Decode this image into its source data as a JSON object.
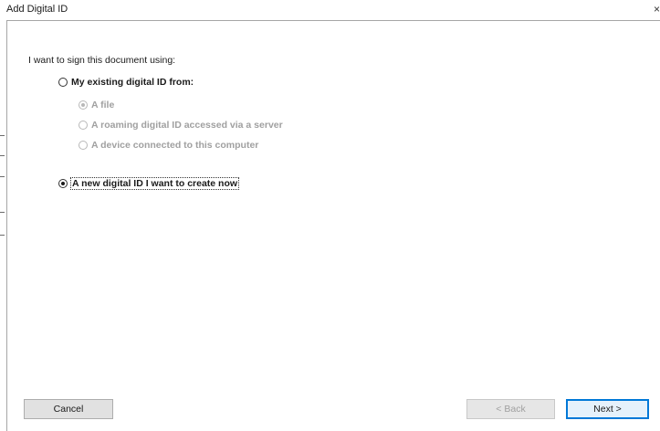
{
  "window": {
    "title": "Add Digital ID",
    "close_glyph": "×"
  },
  "form": {
    "intro": "I want to sign this document using:",
    "existing_option": {
      "label": "My existing digital ID from:",
      "selected": false
    },
    "sub_options": [
      {
        "label": "A file",
        "selected": true,
        "enabled": false
      },
      {
        "label": "A roaming digital ID accessed via a server",
        "selected": false,
        "enabled": false
      },
      {
        "label": "A device connected to this computer",
        "selected": false,
        "enabled": false
      }
    ],
    "new_option": {
      "label": "A new digital ID I want to create now",
      "selected": true
    }
  },
  "buttons": {
    "cancel": "Cancel",
    "back": "< Back",
    "next": "Next >"
  },
  "colors": {
    "default_button_border": "#0078d7",
    "disabled_text": "#a0a0a0"
  }
}
